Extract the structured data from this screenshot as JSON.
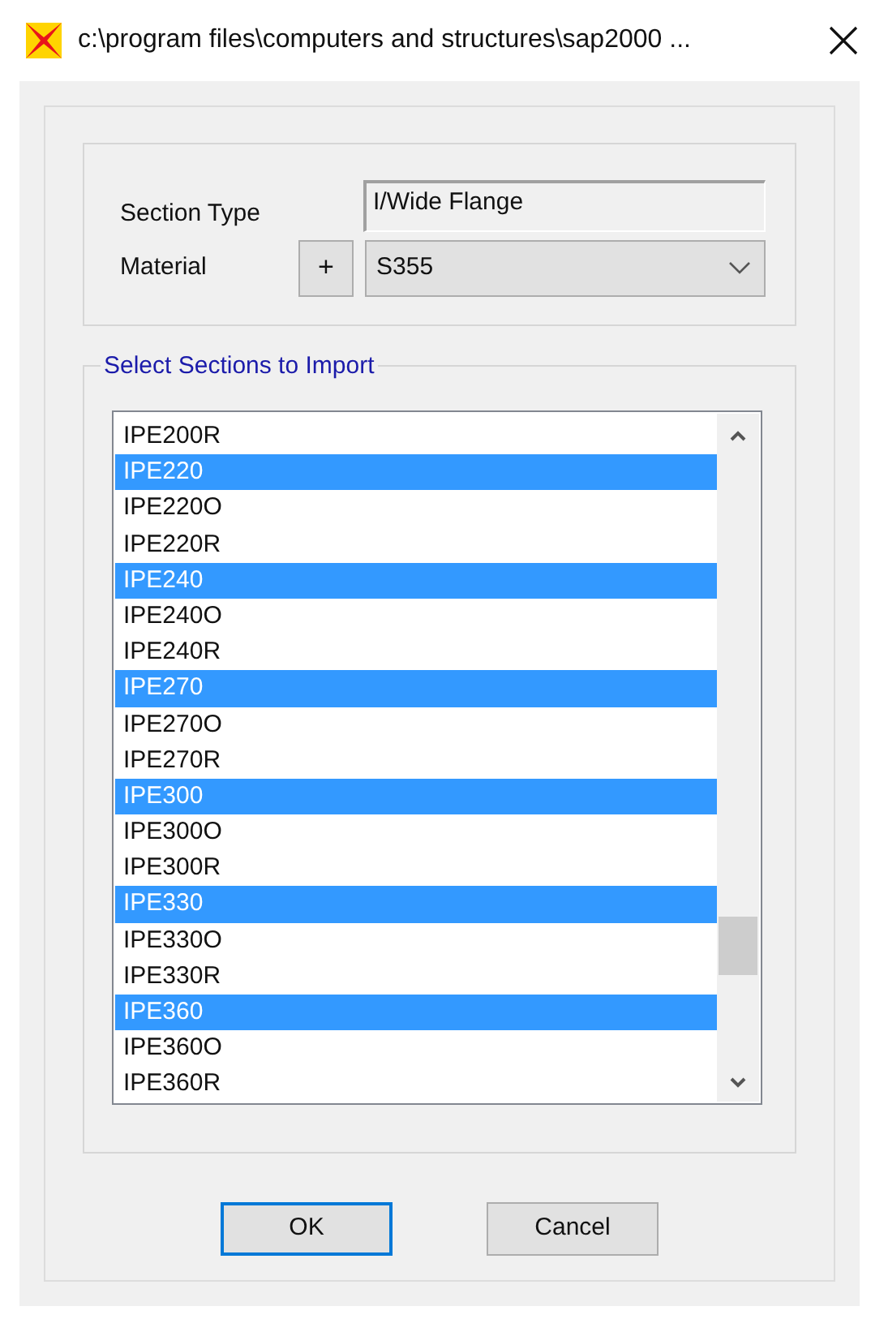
{
  "window": {
    "title": "c:\\program files\\computers and structures\\sap2000 ..."
  },
  "section_type": {
    "label": "Section Type",
    "value": "I/Wide Flange"
  },
  "material": {
    "label": "Material",
    "add_button": "+",
    "value": "S355"
  },
  "sections": {
    "title": "Select Sections to Import",
    "items": [
      {
        "label": "IPE200R",
        "selected": false
      },
      {
        "label": "IPE220",
        "selected": true
      },
      {
        "label": "IPE220O",
        "selected": false
      },
      {
        "label": "IPE220R",
        "selected": false
      },
      {
        "label": "IPE240",
        "selected": true
      },
      {
        "label": "IPE240O",
        "selected": false
      },
      {
        "label": "IPE240R",
        "selected": false
      },
      {
        "label": "IPE270",
        "selected": true
      },
      {
        "label": "IPE270O",
        "selected": false
      },
      {
        "label": "IPE270R",
        "selected": false
      },
      {
        "label": "IPE300",
        "selected": true
      },
      {
        "label": "IPE300O",
        "selected": false
      },
      {
        "label": "IPE300R",
        "selected": false
      },
      {
        "label": "IPE330",
        "selected": true
      },
      {
        "label": "IPE330O",
        "selected": false
      },
      {
        "label": "IPE330R",
        "selected": false
      },
      {
        "label": "IPE360",
        "selected": true
      },
      {
        "label": "IPE360O",
        "selected": false
      },
      {
        "label": "IPE360R",
        "selected": false
      }
    ]
  },
  "buttons": [
    {
      "label": "OK",
      "default": true
    },
    {
      "label": "Cancel",
      "default": false
    }
  ]
}
